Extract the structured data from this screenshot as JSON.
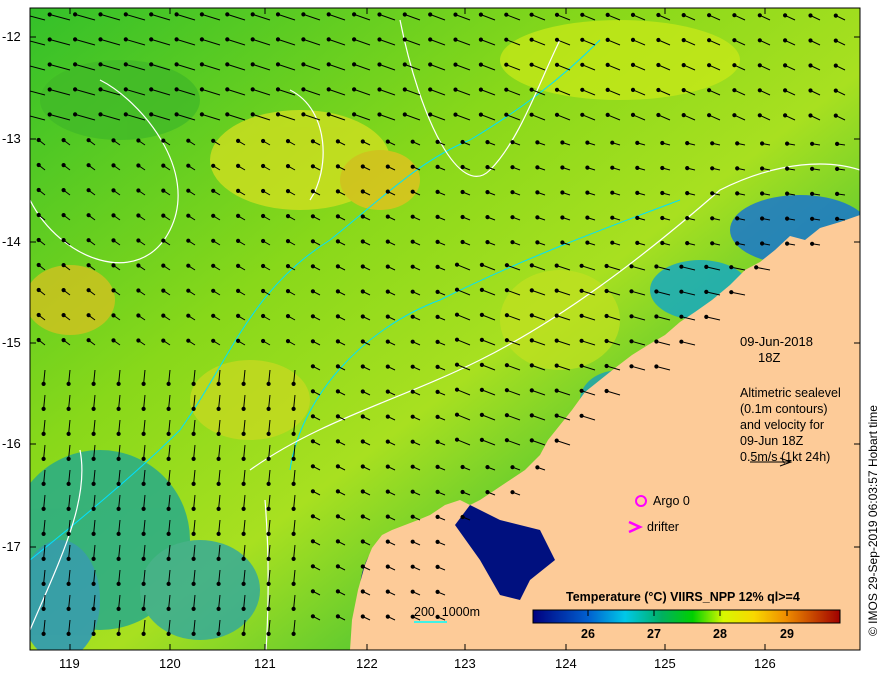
{
  "map": {
    "longitude_ticks": [
      "119",
      "120",
      "121",
      "122",
      "123",
      "124",
      "125",
      "126"
    ],
    "latitude_ticks": [
      "-12",
      "-13",
      "-14",
      "-15",
      "-16",
      "-17"
    ],
    "date": "09-Jun-2018",
    "time": "18Z",
    "altimetry_note": "Altimetric sealevel\n(0.1m contours)\nand velocity for\n09-Jun 18Z\n0.5m/s (1kt 24h)",
    "legend": {
      "argo": "Argo 0",
      "drifter": "drifter",
      "argo_color": "#ff00ff",
      "drifter_color": "#ff00ff"
    },
    "isobath_label": "200  1000m",
    "isobath_color": "#00ffff",
    "land_color": "#fdcb98",
    "colorbar": {
      "title": "Temperature (°C) VIIRS_NPP 12% ql>=4",
      "ticks": [
        "26",
        "27",
        "28",
        "29"
      ],
      "range": [
        25.2,
        29.8
      ]
    },
    "credit": "© IMOS 29-Sep-2019 06:03:57 Hobart time"
  }
}
